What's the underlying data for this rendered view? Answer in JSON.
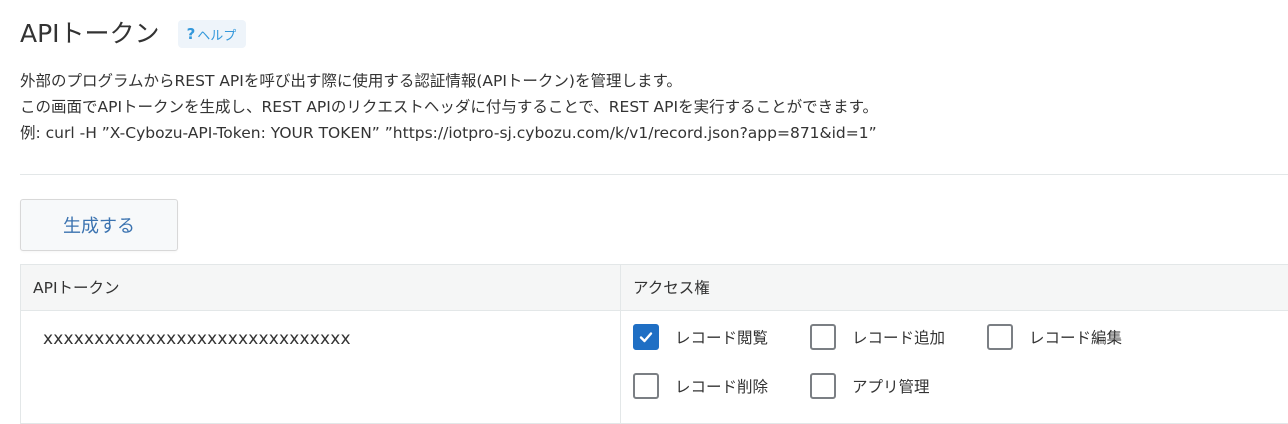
{
  "header": {
    "title": "APIトークン",
    "help_label": "ヘルプ",
    "help_icon": "?"
  },
  "description": {
    "line1": "外部のプログラムからREST APIを呼び出す際に使用する認証情報(APIトークン)を管理します。",
    "line2": "この画面でAPIトークンを生成し、REST APIのリクエストヘッダに付与することで、REST APIを実行することができます。",
    "line3": "例: curl -H ”X-Cybozu-API-Token: YOUR TOKEN” ”https://iotpro-sj.cybozu.com/k/v1/record.json?app=871&id=1”"
  },
  "actions": {
    "generate_label": "生成する"
  },
  "table": {
    "headers": {
      "token": "APIトークン",
      "access": "アクセス権"
    },
    "rows": [
      {
        "token": "xxxxxxxxxxxxxxxxxxxxxxxxxxxxxx",
        "permissions": [
          {
            "label": "レコード閲覧",
            "checked": true
          },
          {
            "label": "レコード追加",
            "checked": false
          },
          {
            "label": "レコード編集",
            "checked": false
          },
          {
            "label": "レコード削除",
            "checked": false
          },
          {
            "label": "アプリ管理",
            "checked": false
          }
        ]
      }
    ]
  },
  "colors": {
    "accent": "#1f6fc4",
    "link": "#3498db",
    "button_text": "#3b73b0"
  }
}
